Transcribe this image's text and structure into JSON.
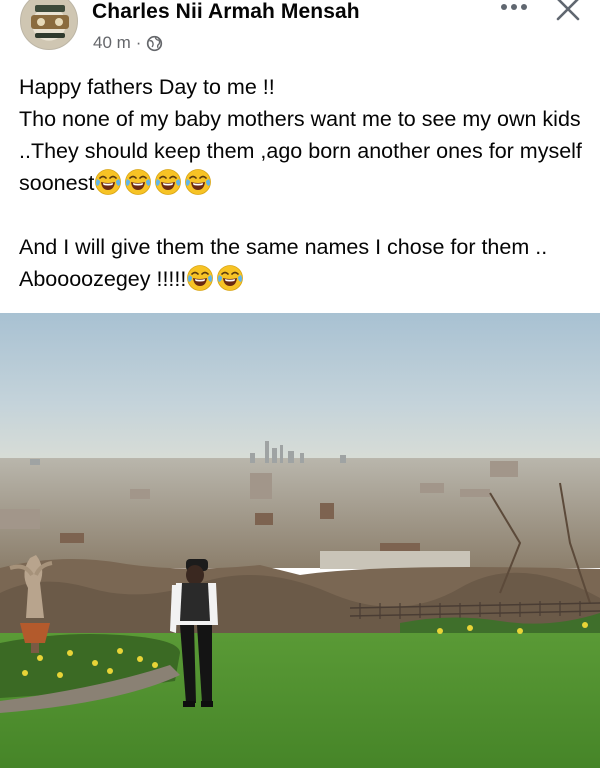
{
  "post": {
    "author": "Charles Nii Armah Mensah",
    "time": "40 m",
    "separator": "·",
    "audience_icon": "globe-icon",
    "line1": "Happy fathers Day to me !!",
    "line2": "Tho none of my baby mothers want me to see my own kids ..They should keep them ,ago born another ones for myself soonest",
    "line2_emoji": "😂😂😂😂",
    "line3": "And I will give them the same names I chose for them .. Aboooozegey !!!!!",
    "line3_emoji": "😂😂"
  },
  "header_actions": {
    "more_icon": "more-horizontal-icon",
    "close_icon": "close-icon"
  },
  "colors": {
    "text": "#050505",
    "meta": "#65676b",
    "sky": "#b7cbd6",
    "grass": "#4f8f2e"
  }
}
